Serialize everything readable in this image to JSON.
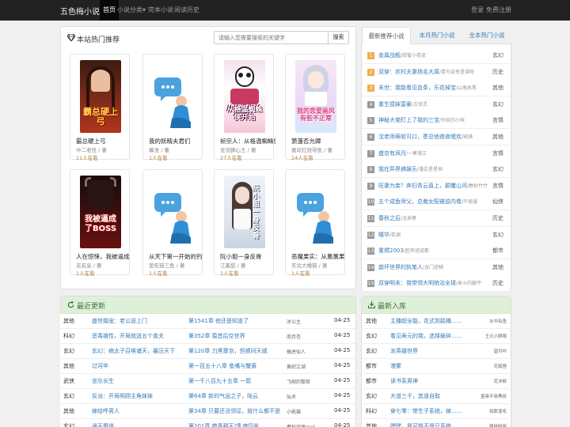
{
  "nav": {
    "brand": "五色梅小说",
    "home": "首页",
    "categories": "小说分类",
    "caret": "▾",
    "finished": "完本小说",
    "history": "阅读历史",
    "login": "登录",
    "register": "免费注册"
  },
  "hot": {
    "title": "本站热门推荐",
    "search_placeholder": "请输入您需要搜索的关键字",
    "search_button": "搜索",
    "books": [
      {
        "name": "霸总硬上弓",
        "author": "中二老怪 / 著",
        "reading": "11人在看",
        "cover": "dark-red",
        "cover_text": "霸总硬上弓"
      },
      {
        "name": "我的妖精夫君们",
        "author": "幕淮 / 著",
        "reading": "1人在看",
        "cover": "placeholder",
        "cover_text": ""
      },
      {
        "name": "祯宗人：从格温蜘蛛侠",
        "author": "龙羽狮心王 / 著",
        "reading": "27人在看",
        "cover": "spider",
        "cover_text": "从格温蜘蛛侠开始"
      },
      {
        "name": "箫蓬否允卿",
        "author": "喜欢红烧带鱼 / 著",
        "reading": "24人在看",
        "cover": "anime",
        "cover_text": "我的恋爱画风有些不正常"
      },
      {
        "name": "人在惊悚，我被逼成",
        "author": "无贫枭 / 著",
        "reading": "1人在看",
        "cover": "demon",
        "cover_text": "我被逼成了BOSS"
      },
      {
        "name": "从天下第一开始的钓",
        "author": "爱吃猫三鱼 / 著",
        "reading": "1人在看",
        "cover": "placeholder",
        "cover_text": ""
      },
      {
        "name": "阮小姐一身反骨",
        "author": "江墨甜 / 著",
        "reading": "1人在看",
        "cover": "girl",
        "cover_text": "阮小姐一身反骨"
      },
      {
        "name": "恶魔果实：从薰薰果",
        "author": "东北大橘猫 / 著",
        "reading": "1人在看",
        "cover": "placeholder",
        "cover_text": ""
      }
    ]
  },
  "tabs": [
    "最新推荐小说",
    "本月热门小说",
    "全本热门小说"
  ],
  "ranking": [
    {
      "n": "1",
      "title": "金属战舰",
      "author": "/甜蜜小卷皮",
      "cat": "玄幻"
    },
    {
      "n": "2",
      "title": "双穿：农村夫妻扬名大周",
      "author": "/青鸟自免是谁呀",
      "cat": "历史"
    },
    {
      "n": "3",
      "title": "末世：我能看见血条，乐花掉宝",
      "author": "/山鬼执笔",
      "cat": "其他"
    },
    {
      "n": "4",
      "title": "重生德妹富豪",
      "author": "/古铁灵",
      "cat": "玄幻"
    },
    {
      "n": "5",
      "title": "神秘大佬盯上了我的三宝",
      "author": "/作妖的小咪",
      "cat": "言情"
    },
    {
      "n": "6",
      "title": "沈老师萌软可口，季总他夜夜缠欢",
      "author": "/鸦满",
      "cat": "其他"
    },
    {
      "n": "7",
      "title": "盛京有凤月",
      "author": "/一寒浦江",
      "cat": "言情"
    },
    {
      "n": "8",
      "title": "我在异界搞娱乐",
      "author": "/潘走星星恒",
      "cat": "玄幻"
    },
    {
      "n": "9",
      "title": "旺妻为妾？弃妇青云直上，颠覆山河",
      "author": "/春秋竹竹",
      "cat": "言情"
    },
    {
      "n": "10",
      "title": "五个成鱼师父，总裁女配被迫内卷",
      "author": "/不易服",
      "cat": "仙侠"
    },
    {
      "n": "11",
      "title": "春秋之后",
      "author": "/龙泉春",
      "cat": "历史"
    },
    {
      "n": "12",
      "title": "瞳华",
      "author": "/若渊",
      "cat": "玄幻"
    },
    {
      "n": "13",
      "title": "重燃2003",
      "author": "/匠师进成都",
      "cat": "都市"
    },
    {
      "n": "14",
      "title": "崩坏世界的执笔人",
      "author": "/龙门逆鳞",
      "cat": "其他"
    },
    {
      "n": "15",
      "title": "双穿明末：我带领大明统治全球",
      "author": "/奋斗的躺平",
      "cat": "历史"
    }
  ],
  "recent": {
    "title": "最近更新",
    "rows": [
      {
        "cat": "其他",
        "title": "盛世婚宠：老公送上门",
        "chapter": "第1541章 他还是知道了",
        "author": "冰公主",
        "date": "04-25"
      },
      {
        "cat": "科幻",
        "title": "恶毒雄性，开局就送五个兽夫",
        "chapter": "第352章 猿首后空世界",
        "author": "南月杏",
        "date": "04-25"
      },
      {
        "cat": "玄幻",
        "title": "玄幻：病太子召唤诸天，暴压天下",
        "chapter": "第120章 刀黑寨京，但顺间天戚",
        "author": "搞虎仙人",
        "date": "04-25"
      },
      {
        "cat": "其他",
        "title": "过河卒",
        "chapter": "第一百五十八章 鱼嘴与蟹黄",
        "author": "黄织江湖",
        "date": "04-25"
      },
      {
        "cat": "武侠",
        "title": "坐忘长生",
        "chapter": "第一千八百九十五章 一箭",
        "author": "飞翔的黎荷",
        "date": "04-25"
      },
      {
        "cat": "玄幻",
        "title": "反派：开局照顾主角妹妹",
        "chapter": "第64章 新的气运之子，陆云",
        "author": "仙术",
        "date": "04-25"
      },
      {
        "cat": "其他",
        "title": "嫁给呼男人",
        "chapter": "第34章 只要还没领证，就什么都不是",
        "author": "小帆猫",
        "date": "04-25"
      },
      {
        "cat": "玄幻",
        "title": "通天魔道",
        "chapter": "第201章 噬毒耕天?乳魂印雀",
        "author": "春秋冠更ssel",
        "date": "04-25"
      }
    ]
  },
  "newbooks": {
    "title": "最新入库",
    "rows": [
      {
        "cat": "其他",
        "title": "主播超全能，花式到路播……",
        "author": "水中有鱼"
      },
      {
        "cat": "玄幻",
        "title": "看见寿元的我，选择破碎……",
        "author": "王元小顾嘻"
      },
      {
        "cat": "玄幻",
        "title": "龙英雄世界",
        "author": "望月吟"
      },
      {
        "cat": "都市",
        "title": "港雾",
        "author": "花狐狸"
      },
      {
        "cat": "都市",
        "title": "读书系男神",
        "author": "花沐柳"
      },
      {
        "cat": "玄幻",
        "title": "大道三千，其道自取",
        "author": "墨染不染黑纹"
      },
      {
        "cat": "科幻",
        "title": "穿七零：带生子系统，嫁……",
        "author": "如那混毛"
      },
      {
        "cat": "其他",
        "title": "嘿嘿，我可能不是只系统",
        "author": "辣妹姐姐"
      }
    ]
  },
  "colors": {
    "navbar": "#222222",
    "link": "#337ab7",
    "green_head": "#dff0d8"
  }
}
